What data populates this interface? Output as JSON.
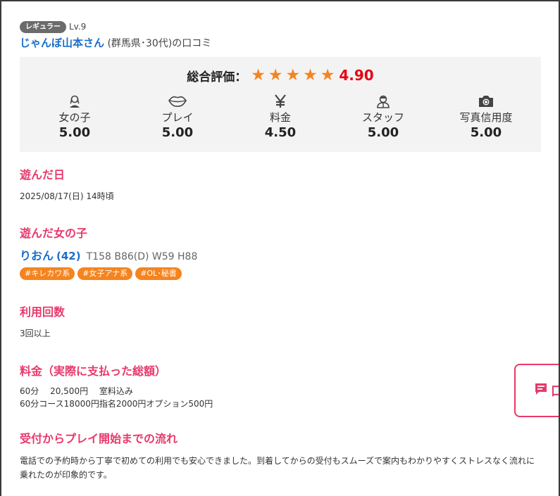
{
  "reviewer": {
    "badge": "レギュラー",
    "level": "Lv.9",
    "name": "じゃんぼ山本さん",
    "info": " (群馬県･30代)の口コミ"
  },
  "rating": {
    "label": "総合評価：",
    "stars": 5,
    "score": "4.90",
    "categories": [
      {
        "icon": "woman-icon",
        "label": "女の子",
        "score": "5.00"
      },
      {
        "icon": "lips-icon",
        "label": "プレイ",
        "score": "5.00"
      },
      {
        "icon": "yen-icon",
        "label": "料金",
        "score": "4.50"
      },
      {
        "icon": "staff-icon",
        "label": "スタッフ",
        "score": "5.00"
      },
      {
        "icon": "camera-icon",
        "label": "写真信用度",
        "score": "5.00"
      }
    ]
  },
  "visit_date": {
    "title": "遊んだ日",
    "value": "2025/08/17(日) 14時頃"
  },
  "girl": {
    "title": "遊んだ女の子",
    "name": "りおん",
    "age": "(42)",
    "stats": "T158 B86(D) W59 H88",
    "tags": [
      "#キレカワ系",
      "#女子アナ系",
      "#OL･秘書"
    ]
  },
  "usage": {
    "title": "利用回数",
    "value": "3回以上"
  },
  "price": {
    "title": "料金（実際に支払った総額）",
    "line1": "60分　 20,500円　 室料込み",
    "line2": "60分コース18000円指名2000円オプション500円"
  },
  "flow": {
    "title": "受付からプレイ開始までの流れ",
    "text": "電話での予約時から丁寧で初めての利用でも安心できました。到着してからの受付もスムーズで案内もわかりやすくストレスなく流れに乗れたのが印象的です。"
  },
  "float_button": {
    "label": "口",
    "icon": "comment-icon"
  },
  "colors": {
    "accent_pink": "#e8396b",
    "star_orange": "#f5841f",
    "score_red": "#e60012",
    "link_blue": "#1a6fc9"
  }
}
